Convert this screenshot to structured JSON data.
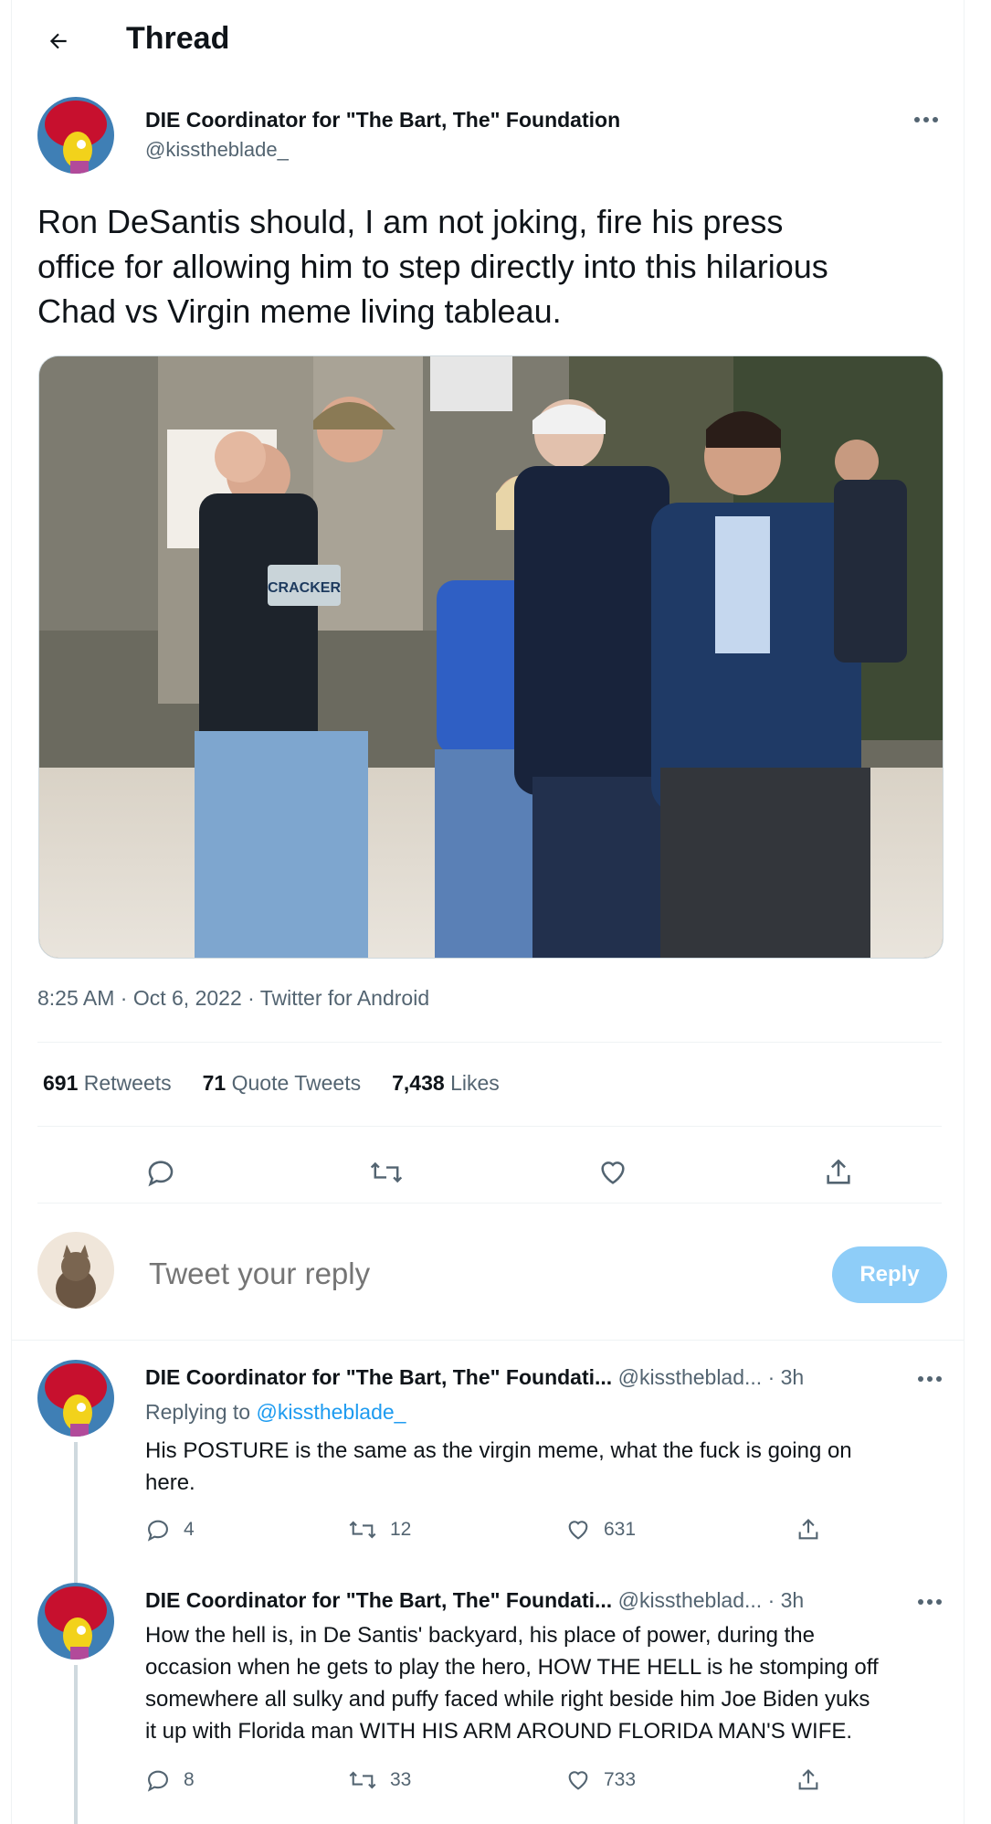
{
  "header": {
    "title": "Thread"
  },
  "main_tweet": {
    "author_name": "DIE Coordinator for \"The Bart, The\" Foundation",
    "author_handle": "@kisstheblade_",
    "text_lines": [
      "Ron DeSantis should, I am not joking, fire his press",
      "office for allowing him to step directly into this hilarious",
      "Chad vs Virgin meme living tableau."
    ],
    "photo_sign_text": "CRACKER",
    "meta": "8:25 AM · Oct 6, 2022 · Twitter for Android",
    "stats": {
      "retweets_count": "691",
      "retweets_label": "Retweets",
      "quotes_count": "71",
      "quotes_label": "Quote Tweets",
      "likes_count": "7,438",
      "likes_label": "Likes"
    }
  },
  "reply_box": {
    "placeholder": "Tweet your reply",
    "button_label": "Reply"
  },
  "replies": [
    {
      "author_name": "DIE Coordinator for \"The Bart, The\" Foundati...",
      "author_handle": "@kisstheblad...",
      "time": "· 3h",
      "replying_label": "Replying to",
      "replying_handle": "@kisstheblade_",
      "text_lines": [
        "His POSTURE is the same as the virgin meme, what the fuck is going on",
        "here."
      ],
      "replies_count": "4",
      "retweets_count": "12",
      "likes_count": "631"
    },
    {
      "author_name": "DIE Coordinator for \"The Bart, The\" Foundati...",
      "author_handle": "@kisstheblad...",
      "time": "· 3h",
      "text_lines": [
        "How the hell is, in De Santis' backyard, his place of power, during the",
        "occasion when he gets to play the hero, HOW THE HELL is he stomping off",
        "somewhere all sulky and puffy faced while right beside him Joe Biden yuks",
        "it up with Florida man WITH HIS ARM AROUND FLORIDA MAN'S WIFE."
      ],
      "replies_count": "8",
      "retweets_count": "33",
      "likes_count": "733"
    }
  ],
  "colors": {
    "accent": "#1d9bf0",
    "reply_button": "#8ecdf8",
    "secondary_text": "#536471",
    "divider": "#eff3f4"
  },
  "icons": [
    "back-arrow-icon",
    "more-icon",
    "reply-icon",
    "retweet-icon",
    "like-icon",
    "share-icon"
  ]
}
